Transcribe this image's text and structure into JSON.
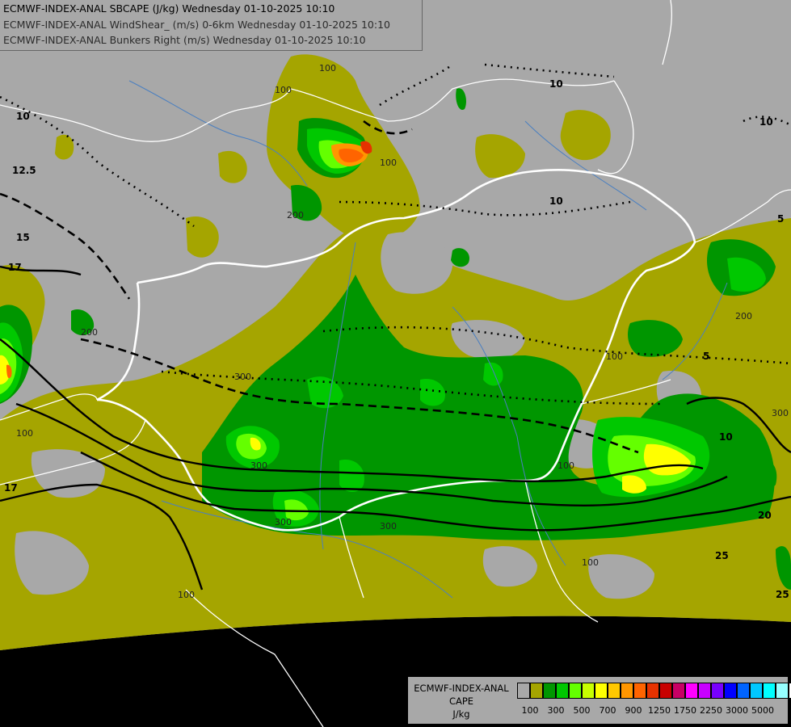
{
  "header": {
    "line1": "ECMWF-INDEX-ANAL SBCAPE (J/kg) Wednesday 01-10-2025 10:10",
    "line2": "ECMWF-INDEX-ANAL WindShear_ (m/s) 0-6km Wednesday 01-10-2025 10:10",
    "line3": "ECMWF-INDEX-ANAL Bunkers Right (m/s) Wednesday 01-10-2025 10:10"
  },
  "legend": {
    "title1": "ECMWF-INDEX-ANAL",
    "title2": "CAPE",
    "title3": "J/kg",
    "colors": [
      "#a8a8a8",
      "#a5a500",
      "#009600",
      "#00c800",
      "#64ff00",
      "#c8ff00",
      "#ffff00",
      "#ffc800",
      "#ff9600",
      "#ff6400",
      "#e63200",
      "#c80000",
      "#c80064",
      "#ff00ff",
      "#c800ff",
      "#7800ff",
      "#0000ff",
      "#0064ff",
      "#00c8ff",
      "#00ffff",
      "#96ffff",
      "#ffffff"
    ],
    "ticks": [
      "100",
      "300",
      "500",
      "700",
      "900",
      "1250",
      "1750",
      "2250",
      "3000",
      "5000"
    ]
  },
  "map": {
    "colors": {
      "background": "#000000",
      "domain": "#a8a8a8",
      "cape_100": "#a5a500",
      "cape_300": "#009600",
      "cape_500": "#00c800",
      "cape_700": "#64ff00",
      "cape_900": "#ffff00",
      "cape_1250": "#ff9600",
      "cape_1750": "#e63200",
      "border": "#ffffff",
      "river": "#4a7fc0"
    },
    "contour_labels": [
      "100",
      "200",
      "300",
      "400",
      "10",
      "12.5",
      "15",
      "17",
      "5",
      "20",
      "25",
      "10",
      "100",
      "300",
      "200",
      "100",
      "5"
    ]
  }
}
